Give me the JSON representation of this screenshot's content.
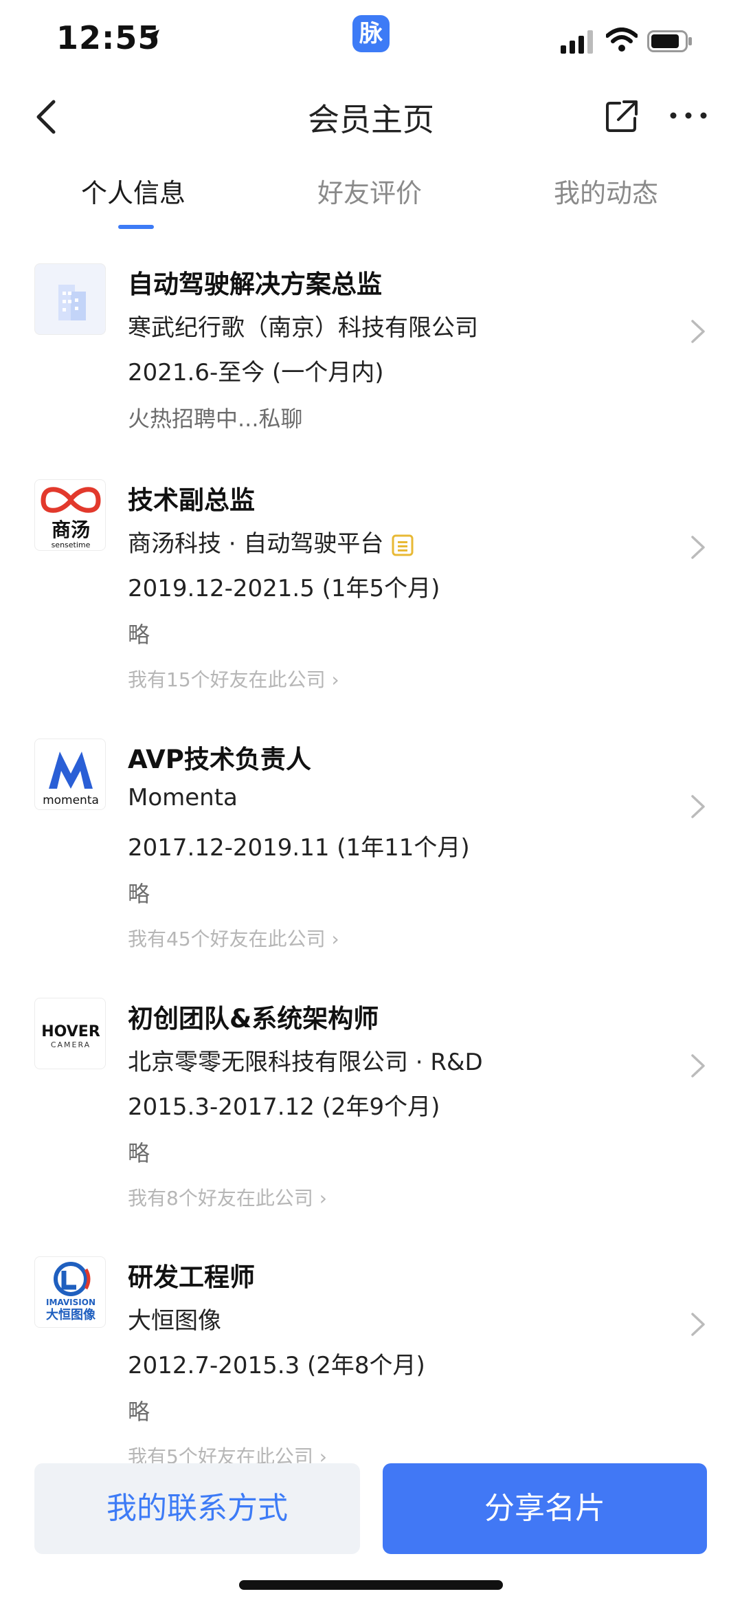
{
  "status_bar": {
    "time": "12:55",
    "app_badge": "脉"
  },
  "nav": {
    "title": "会员主页"
  },
  "tabs": [
    {
      "label": "个人信息",
      "active": true
    },
    {
      "label": "好友评价",
      "active": false
    },
    {
      "label": "我的动态",
      "active": false
    }
  ],
  "jobs": [
    {
      "title": "自动驾驶解决方案总监",
      "company": "寒武纪行歌（南京）科技有限公司",
      "period": "2021.6-至今 (一个月内)",
      "description": "火热招聘中...私聊",
      "logo": "building-icon"
    },
    {
      "title": "技术副总监",
      "company": "商汤科技 · 自动驾驶平台",
      "period": "2019.12-2021.5 (1年5个月)",
      "description": "略",
      "friends": "我有15个好友在此公司",
      "logo": "sensetime-logo",
      "logo_text": "商汤",
      "logo_sub": "sensetime",
      "verified": true
    },
    {
      "title": "AVP技术负责人",
      "company": "Momenta",
      "period": "2017.12-2019.11 (1年11个月)",
      "description": "略",
      "friends": "我有45个好友在此公司",
      "logo": "momenta-logo",
      "logo_text": "momenta"
    },
    {
      "title": "初创团队&系统架构师",
      "company": "北京零零无限科技有限公司 · R&D",
      "period": "2015.3-2017.12 (2年9个月)",
      "description": "略",
      "friends": "我有8个好友在此公司",
      "logo": "hover-camera-logo",
      "logo_text": "HOVER",
      "logo_sub": "CAMERA"
    },
    {
      "title": "研发工程师",
      "company": "大恒图像",
      "period": "2012.7-2015.3 (2年8个月)",
      "description": "略",
      "friends": "我有5个好友在此公司",
      "logo": "imavision-logo",
      "logo_text": "IMAVISION",
      "logo_sub": "大恒图像"
    }
  ],
  "buttons": {
    "contact": "我的联系方式",
    "share_card": "分享名片"
  },
  "colors": {
    "accent": "#3d7bf6",
    "button_secondary_bg": "#eff2f6"
  }
}
